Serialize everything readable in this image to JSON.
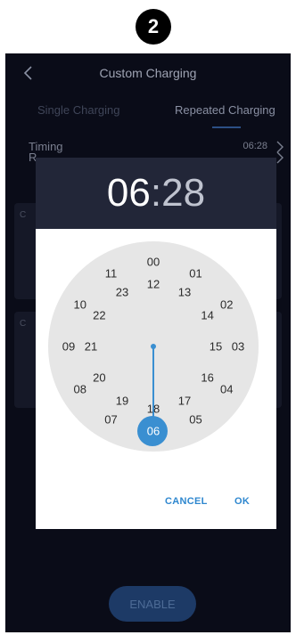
{
  "step_badge": "2",
  "header": {
    "title": "Custom Charging",
    "back_icon": "chevron-left-icon"
  },
  "tabs": [
    {
      "label": "Single Charging",
      "active": false
    },
    {
      "label": "Repeated Charging",
      "active": true
    }
  ],
  "rows": [
    {
      "label": "Timing",
      "value": "06:28"
    },
    {
      "label": "R",
      "value": ""
    }
  ],
  "cards": [
    {
      "letter": "C"
    },
    {
      "letter": "C"
    }
  ],
  "enable_button": "ENABLE",
  "time_picker": {
    "hour": "06",
    "colon": ":",
    "minute": "28",
    "selected_hour": "06",
    "outer_ring": [
      "00",
      "01",
      "02",
      "03",
      "04",
      "05",
      "06",
      "07",
      "08",
      "09",
      "10",
      "11"
    ],
    "inner_ring": [
      "12",
      "13",
      "14",
      "15",
      "16",
      "17",
      "18",
      "19",
      "20",
      "21",
      "22",
      "23"
    ],
    "cancel_label": "CANCEL",
    "ok_label": "OK"
  },
  "colors": {
    "accent": "#3a8fd1",
    "background": "#0a0c18",
    "dialog_header": "#222638"
  }
}
